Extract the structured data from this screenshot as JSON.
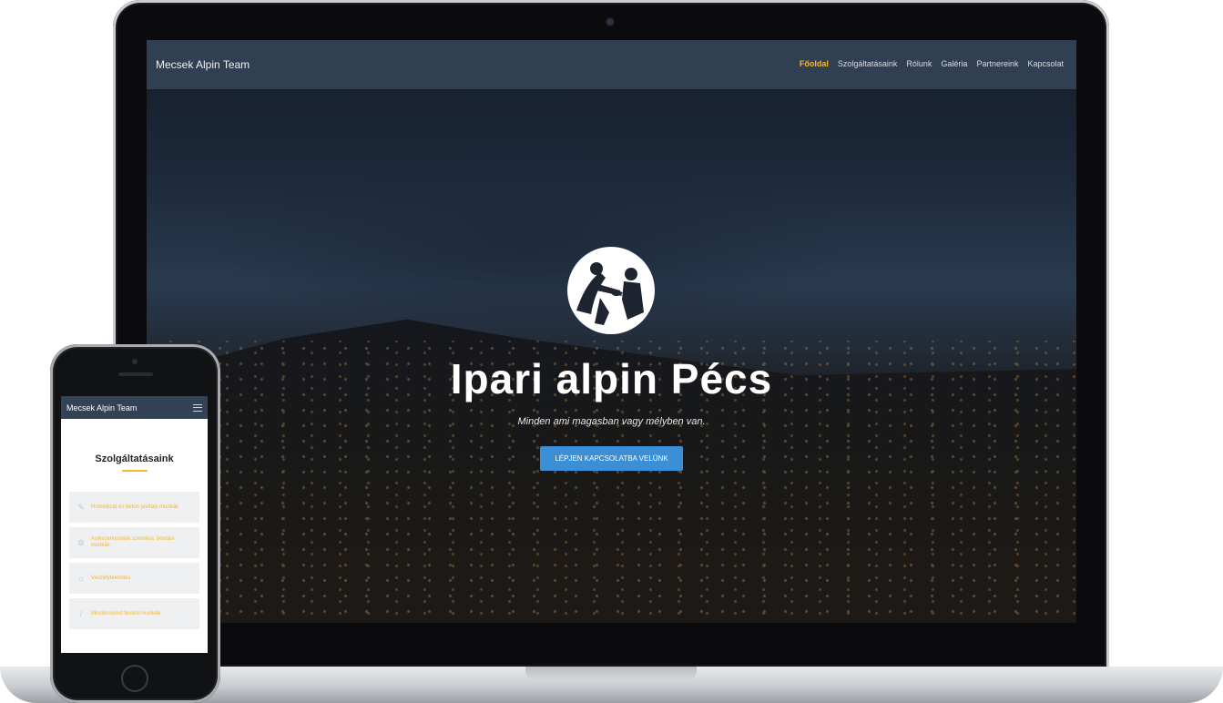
{
  "laptop": {
    "brand": "Mecsek Alpin Team",
    "nav": [
      "Főoldal",
      "Szolgáltatásaink",
      "Rólunk",
      "Galéria",
      "Partnereink",
      "Kapcsolat"
    ],
    "active_nav": "Főoldal",
    "hero": {
      "logo_icon": "climbers-logo-icon",
      "title": "Ipari alpin Pécs",
      "subtitle": "Minden ami magasban vagy mélyben van.",
      "cta_label": "LÉPJEN KAPCSOLATBA VELÜNK"
    }
  },
  "phone": {
    "brand": "Mecsek Alpin Team",
    "menu_icon": "hamburger-menu-icon",
    "section_title": "Szolgáltatásaink",
    "services": [
      {
        "icon": "wrench-icon",
        "label": "Homlokzat és beton javítási munkák"
      },
      {
        "icon": "gears-icon",
        "label": "Acélszerkezetek szerelési, bontási munkák"
      },
      {
        "icon": "home-icon",
        "label": "Veszélytelenítés"
      },
      {
        "icon": "brush-icon",
        "label": "Mindennemű festési munkák"
      }
    ]
  },
  "colors": {
    "accent": "#f5b82e",
    "navbar": "#344256",
    "cta": "#3a8fd6"
  }
}
